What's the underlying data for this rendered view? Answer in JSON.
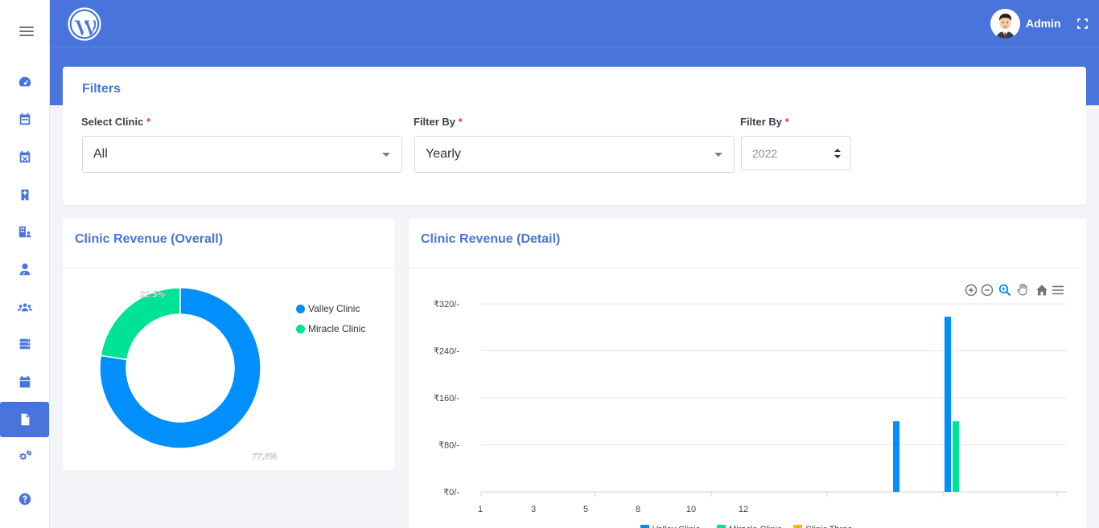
{
  "sidebar": {
    "menu_icon": "hamburger-icon",
    "items": [
      {
        "name": "dashboard",
        "icon": "speedometer-icon",
        "active": false
      },
      {
        "name": "appointments",
        "icon": "calendar-icon",
        "active": false
      },
      {
        "name": "cancelled",
        "icon": "calendar-x-icon",
        "active": false
      },
      {
        "name": "clinics",
        "icon": "hospital-icon",
        "active": false
      },
      {
        "name": "clinic-users",
        "icon": "building-user-icon",
        "active": false
      },
      {
        "name": "doctors",
        "icon": "doctor-icon",
        "active": false
      },
      {
        "name": "patients",
        "icon": "users-icon",
        "active": false
      },
      {
        "name": "services",
        "icon": "server-icon",
        "active": false
      },
      {
        "name": "schedule",
        "icon": "calendar-full-icon",
        "active": false
      },
      {
        "name": "reports",
        "icon": "document-icon",
        "active": true
      },
      {
        "name": "settings",
        "icon": "cogs-icon",
        "active": false
      },
      {
        "name": "help",
        "icon": "question-icon",
        "active": false
      }
    ]
  },
  "header": {
    "logo": "wordpress-logo",
    "user_name": "Admin",
    "fullscreen_icon": "expand-icon"
  },
  "filters": {
    "title": "Filters",
    "clinic_label": "Select Clinic",
    "clinic_value": "All",
    "filterby_label": "Filter By",
    "filterby_value": "Yearly",
    "year_label": "Filter By",
    "year_value": "2022",
    "required_mark": "*"
  },
  "pie_card": {
    "title": "Clinic Revenue (Overall)"
  },
  "bar_card": {
    "title": "Clinic Revenue (Detail)",
    "toolbar": [
      "zoom-in-icon",
      "zoom-out-icon",
      "zoom-selection-icon",
      "pan-hand-icon",
      "home-icon",
      "menu-icon"
    ]
  },
  "colors": {
    "primary": "#4874dc",
    "valley": "#008ffb",
    "miracle": "#00e396",
    "three": "#feb019"
  },
  "chart_data": [
    {
      "type": "pie",
      "labels": [
        "Valley Clinic",
        "Miracle Clinic"
      ],
      "values": [
        77.5,
        22.5
      ],
      "data_labels": [
        "77.5%",
        "22.5%"
      ],
      "legend_position": "right"
    },
    {
      "type": "bar",
      "x_ticks": [
        "1",
        "3",
        "5",
        "8",
        "10",
        "12"
      ],
      "y_ticks": [
        "₹320/-",
        "₹240/-",
        "₹160/-",
        "₹80/-",
        "₹0/-"
      ],
      "ylim": [
        0,
        320
      ],
      "series": [
        {
          "name": "Valley Clinic",
          "points": [
            {
              "x": 1,
              "y": 120
            },
            {
              "x": 2,
              "y": 298
            }
          ]
        },
        {
          "name": "Miracle Clinic",
          "points": [
            {
              "x": 1,
              "y": 0
            },
            {
              "x": 2,
              "y": 120
            }
          ]
        },
        {
          "name": "Clinic Three",
          "points": []
        }
      ],
      "legend_position": "bottom",
      "grid": true
    }
  ]
}
